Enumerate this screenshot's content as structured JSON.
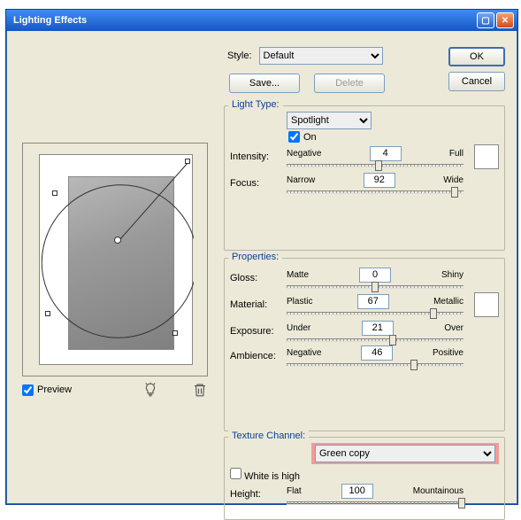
{
  "window": {
    "title": "Lighting Effects"
  },
  "style": {
    "label": "Style:",
    "selected": "Default",
    "save": "Save...",
    "delete": "Delete"
  },
  "actions": {
    "ok": "OK",
    "cancel": "Cancel"
  },
  "preview": {
    "label": "Preview"
  },
  "light": {
    "legend": "Light Type:",
    "type_selected": "Spotlight",
    "on_label": "On",
    "intensity": {
      "label": "Intensity:",
      "left": "Negative",
      "right": "Full",
      "value": "4",
      "pos": 52
    },
    "focus": {
      "label": "Focus:",
      "left": "Narrow",
      "right": "Wide",
      "value": "92",
      "pos": 95
    }
  },
  "props": {
    "legend": "Properties:",
    "gloss": {
      "label": "Gloss:",
      "left": "Matte",
      "right": "Shiny",
      "value": "0",
      "pos": 50
    },
    "material": {
      "label": "Material:",
      "left": "Plastic",
      "right": "Metallic",
      "value": "67",
      "pos": 83
    },
    "exposure": {
      "label": "Exposure:",
      "left": "Under",
      "right": "Over",
      "value": "21",
      "pos": 60
    },
    "ambience": {
      "label": "Ambience:",
      "left": "Negative",
      "right": "Positive",
      "value": "46",
      "pos": 72
    }
  },
  "texture": {
    "legend": "Texture Channel:",
    "selected": "Green copy",
    "white_label": "White is high",
    "height": {
      "label": "Height:",
      "left": "Flat",
      "right": "Mountainous",
      "value": "100",
      "pos": 99
    }
  }
}
